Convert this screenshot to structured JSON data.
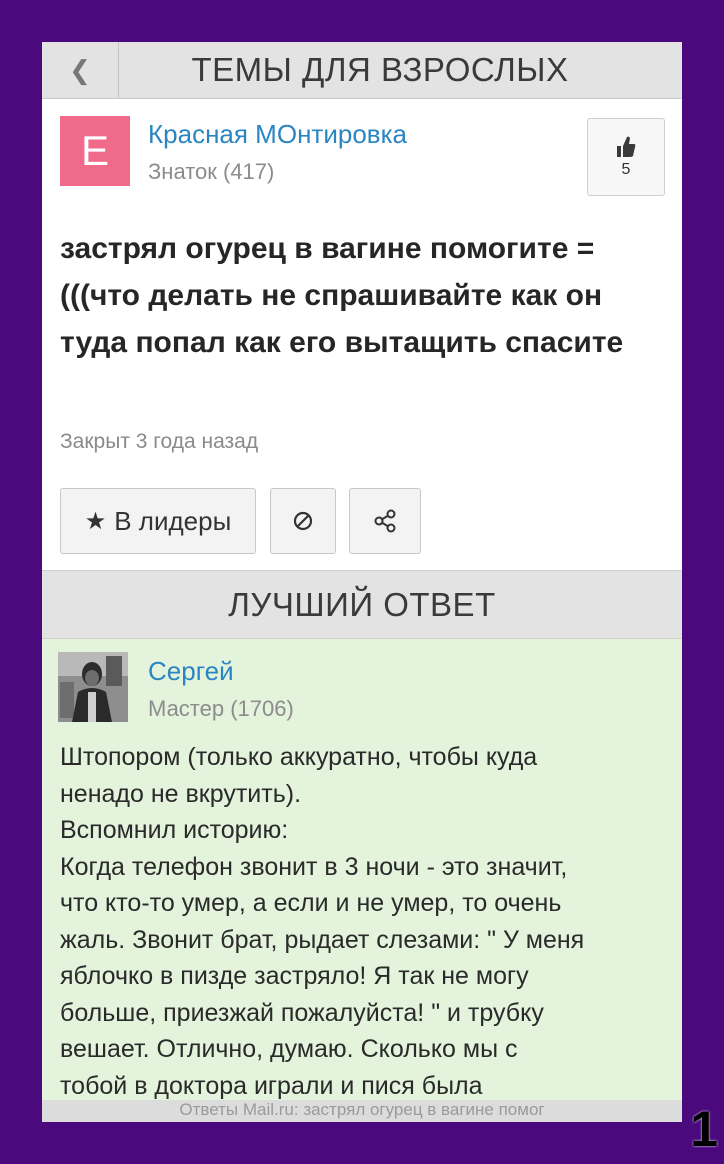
{
  "header": {
    "back_icon": "chevron-left-icon",
    "title": "ТЕМЫ ДЛЯ ВЗРОСЛЫХ"
  },
  "question": {
    "author": {
      "avatar_letter": "E",
      "avatar_color": "#f06a8a",
      "name": "Красная МОнтировка",
      "rank": "Знаток (417)"
    },
    "likes": {
      "icon": "thumbs-up-icon",
      "count": "5"
    },
    "text": "застрял огурец в вагине помогите =(((что делать не спрашивайте как он туда попал как его вытащить спасите",
    "status": "Закрыт 3 года назад",
    "actions": {
      "leaders_label": "В лидеры",
      "leaders_icon": "star-icon",
      "block_icon": "block-icon",
      "share_icon": "share-icon"
    }
  },
  "best_answer": {
    "heading": "ЛУЧШИЙ ОТВЕТ",
    "author": {
      "name": "Сергей",
      "rank": "Мастер (1706)"
    },
    "text": "Штопором (только аккуратно, чтобы куда\nненадо не вкрутить).\nВспомнил историю:\nКогда телефон звонит в 3 ночи - это значит,\nчто кто-то умер, а если и не умер, то очень\nжаль. Звонит брат, рыдает слезами: \" У меня\nяблочко в пизде застряло! Я так не могу\nбольше, приезжай пожалуйста! \" и трубку\nвешает. Отлично, думаю. Сколько мы с\nтобой в доктора играли и пися была"
  },
  "footer": {
    "text": "Ответы Mail.ru: застрял огурец в вагине помог"
  },
  "page_number": "1"
}
